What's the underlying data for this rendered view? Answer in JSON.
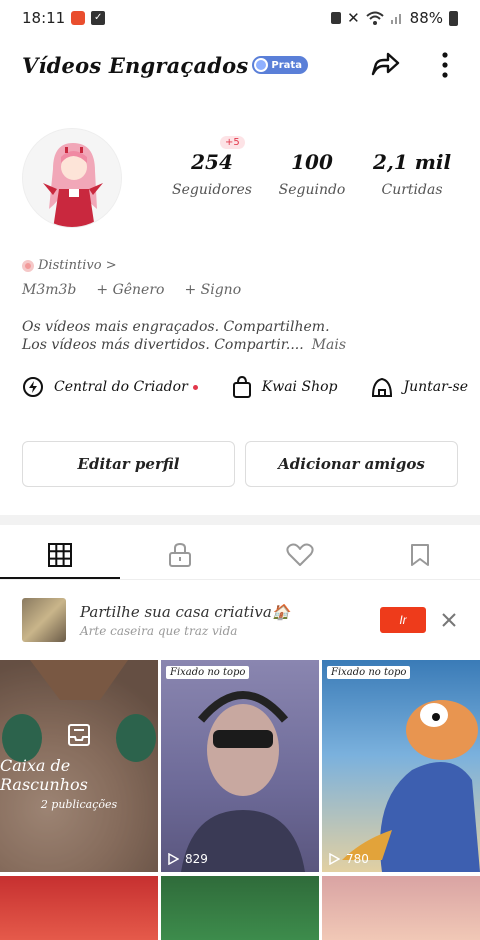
{
  "status_bar": {
    "time": "18:11",
    "battery": "88%"
  },
  "header": {
    "title": "Vídeos Engraçados",
    "badge": "Prata"
  },
  "profile": {
    "stats": [
      {
        "value": "254",
        "label": "Seguidores",
        "badge": "+5"
      },
      {
        "value": "100",
        "label": "Seguindo"
      },
      {
        "value": "2,1 mil",
        "label": "Curtidas"
      }
    ],
    "distintivo": "Distintivo >",
    "tags": [
      "M3m3b",
      "+ Gênero",
      "+ Signo"
    ],
    "bio_line1": "Os vídeos mais engraçados. Compartilhem.",
    "bio_line2": "Los vídeos más divertidos. Compartir....",
    "bio_more": "Mais"
  },
  "creator_row": {
    "items": [
      "Central do Criador",
      "Kwai Shop",
      "Juntar-se"
    ]
  },
  "buttons": {
    "edit": "Editar perfil",
    "add_friends": "Adicionar amigos"
  },
  "promo": {
    "title": "Partilhe sua casa criativa🏠",
    "subtitle": "Arte caseira que traz vida",
    "cta": "Ir"
  },
  "grid": {
    "drafts_title": "Caixa de Rascunhos",
    "drafts_count": "2 publicações",
    "pinned_label": "Fixado no topo",
    "video2_views": "829",
    "video3_views": "780"
  }
}
